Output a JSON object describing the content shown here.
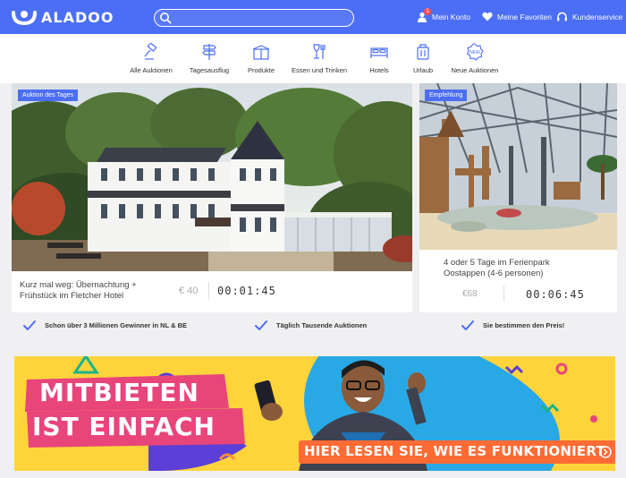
{
  "header": {
    "brand": "ALADOO",
    "search": {
      "placeholder": "",
      "value": ""
    },
    "links": {
      "account": "Mein Konto",
      "account_badge": "1",
      "favorites": "Meine Favoriten",
      "service": "Kundenservice"
    }
  },
  "categories": [
    {
      "label": "Alle Auktionen",
      "icon": "gavel-icon"
    },
    {
      "label": "Tagesausflug",
      "icon": "signpost-icon"
    },
    {
      "label": "Produkte",
      "icon": "gift-box-icon"
    },
    {
      "label": "Essen und Trinken",
      "icon": "wine-glass-icon"
    },
    {
      "label": "Hotels",
      "icon": "bed-icon"
    },
    {
      "label": "Urlaub",
      "icon": "suitcase-icon"
    },
    {
      "label": "Neue Auktionen",
      "icon": "new-seal-icon"
    }
  ],
  "auctions": {
    "featured": {
      "ribbon": "Auktion des Tages",
      "title_line1": "Kurz mal weg: Übernachtung +",
      "title_line2": "Frühstück im Fletcher Hotel",
      "price": "€ 40",
      "timer": "00:01:45"
    },
    "recommended": {
      "ribbon": "Empfehlung",
      "title_line1": "4 oder 5 Tage im Ferienpark",
      "title_line2": "Oostappen (4-6 personen)",
      "price": "€68",
      "timer": "00:06:45"
    }
  },
  "features": [
    "Schon über 3 Millionen Gewinner in NL & BE",
    "Täglich Tausende Auktionen",
    "Sie bestimmen den Preis!"
  ],
  "banner": {
    "headline_line1": "MITBIETEN",
    "headline_line2": "IST EINFACH",
    "cta": "HIER LESEN SIE, WIE ES FUNKTIONIERT"
  },
  "colors": {
    "brand_blue": "#4c6ef5",
    "banner_blue": "#29a8e6",
    "banner_pink": "#e8457a",
    "cta_orange": "#ff6b35"
  }
}
